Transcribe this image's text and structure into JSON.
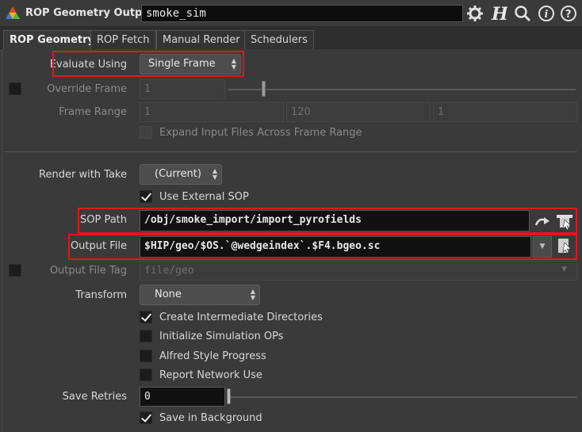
{
  "header": {
    "node_type": "ROP Geometry Output",
    "node_name": "smoke_sim",
    "icons": [
      "gear-icon",
      "houdini-h-icon",
      "search-icon",
      "info-icon",
      "help-icon"
    ]
  },
  "tabs": [
    {
      "label": "ROP Geometry",
      "active": true
    },
    {
      "label": "ROP Fetch",
      "active": false
    },
    {
      "label": "Manual Render",
      "active": false
    },
    {
      "label": "Schedulers",
      "active": false
    }
  ],
  "params": {
    "evaluate_using": {
      "label": "Evaluate Using",
      "value": "Single Frame"
    },
    "override_frame": {
      "label": "Override Frame",
      "value": "1"
    },
    "frame_range": {
      "label": "Frame Range",
      "start": "1",
      "end": "120",
      "inc": "1"
    },
    "expand_input": {
      "label": "Expand Input Files Across Frame Range"
    },
    "render_with_take": {
      "label": "Render with Take",
      "value": "(Current)"
    },
    "use_external_sop": {
      "label": "Use External SOP",
      "checked": true
    },
    "sop_path": {
      "label": "SOP Path",
      "value": "/obj/smoke_import/import_pyrofields"
    },
    "output_file": {
      "label": "Output File",
      "value": "$HIP/geo/$OS.`@wedgeindex`.$F4.bgeo.sc"
    },
    "output_file_tag": {
      "label": "Output File Tag",
      "placeholder": "file/geo"
    },
    "transform": {
      "label": "Transform",
      "value": "None"
    },
    "create_dirs": {
      "label": "Create Intermediate Directories",
      "checked": true
    },
    "init_sim": {
      "label": "Initialize Simulation OPs",
      "checked": false
    },
    "alfred": {
      "label": "Alfred Style Progress",
      "checked": false
    },
    "report_net": {
      "label": "Report Network Use",
      "checked": false
    },
    "save_retries": {
      "label": "Save Retries",
      "value": "0"
    },
    "save_background": {
      "label": "Save in Background",
      "checked": true
    }
  },
  "colors": {
    "highlight": "#e3171c",
    "background": "#3a3a3a"
  }
}
